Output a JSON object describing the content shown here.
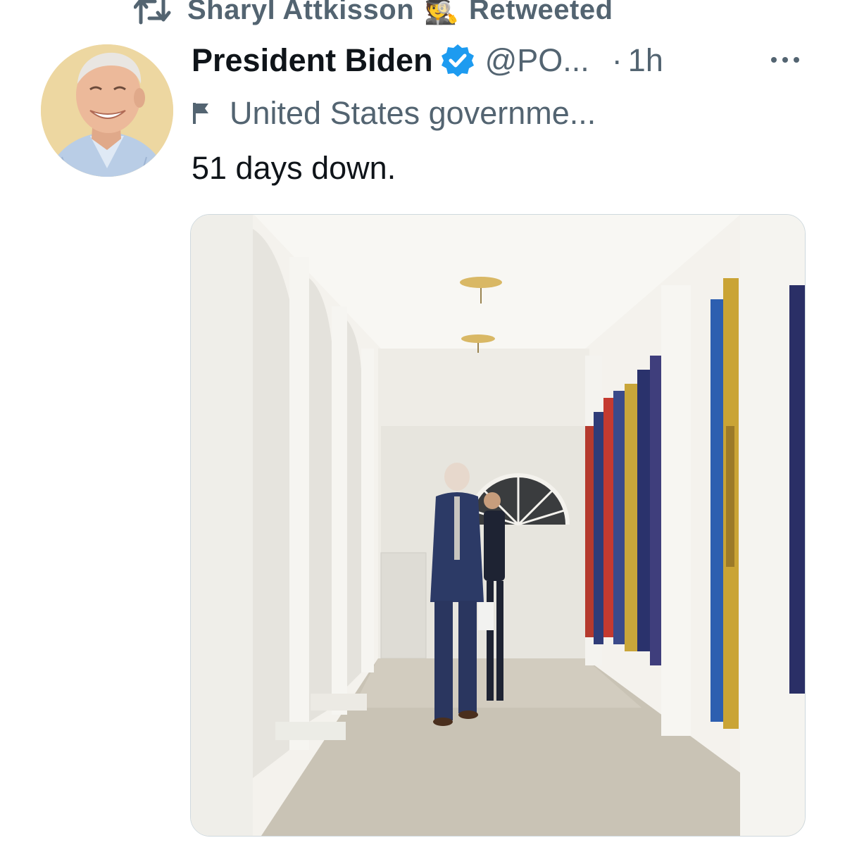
{
  "retweet": {
    "icon": "retweet-icon",
    "user": "Sharyl Attkisson",
    "emoji": "🕵️",
    "suffix": "Retweeted"
  },
  "tweet": {
    "author": {
      "display_name": "President Biden",
      "verified_icon": "verified-badge-icon",
      "handle": "@PO...",
      "avatar": "profile-photo"
    },
    "separator": "·",
    "time": "1h",
    "more_icon": "more-options-icon",
    "label": {
      "icon": "flag-icon",
      "text": "United States governme..."
    },
    "text": "51 days down.",
    "media": {
      "type": "video-still",
      "description_icon": "colonnade-photo"
    }
  },
  "colors": {
    "text_primary": "#0f1419",
    "text_secondary": "#536471",
    "verified": "#1d9bf0"
  }
}
